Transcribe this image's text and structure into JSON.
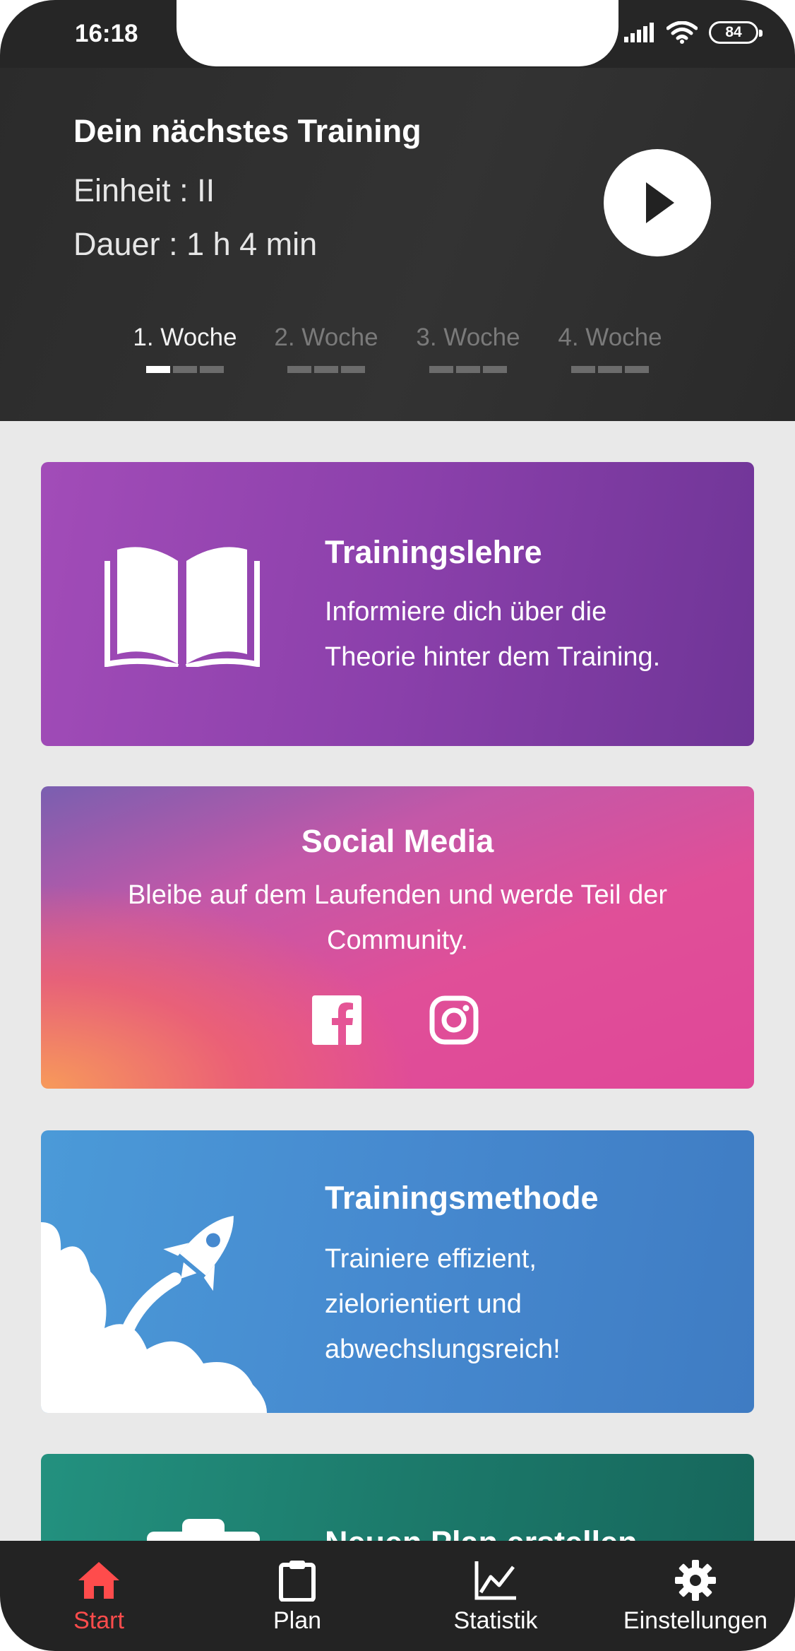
{
  "status_bar": {
    "time": "16:18",
    "battery": "84"
  },
  "next_training": {
    "title": "Dein nächstes Training",
    "unit_line": "Einheit : II",
    "duration_line": "Dauer :  1 h 4 min",
    "weeks": [
      "1. Woche",
      "2. Woche",
      "3. Woche",
      "4. Woche"
    ],
    "active_week": "1. Woche"
  },
  "cards": {
    "trainingslehre": {
      "title": "Trainingslehre",
      "desc_1": "Informiere dich über die",
      "desc_2": "Theorie hinter dem Training.",
      "icon": "open-book-icon"
    },
    "social": {
      "title": "Social Media",
      "desc_1": "Bleibe auf dem Laufenden und werde Teil der",
      "desc_2": "Community.",
      "icons": [
        "facebook-icon",
        "instagram-icon"
      ]
    },
    "methode": {
      "title": "Trainingsmethode",
      "desc_1": "Trainiere effizient,",
      "desc_2": "zielorientiert und",
      "desc_3": "abwechslungsreich!",
      "icon": "rocket-icon"
    },
    "neuer_plan": {
      "title": "Neuen Plan erstellen",
      "icon": "clipboard-icon"
    }
  },
  "bottom_nav": {
    "items": [
      {
        "label": "Start",
        "icon": "home-icon",
        "active": true
      },
      {
        "label": "Plan",
        "icon": "clipboard-icon"
      },
      {
        "label": "Statistik",
        "icon": "chart-icon"
      },
      {
        "label": "Einstellungen",
        "icon": "gear-icon"
      }
    ]
  },
  "colors": {
    "accent": "#ff4c4c",
    "header_bg": "#2e2e2e",
    "card_purple": "#8b40ab",
    "card_blue": "#4689cf",
    "card_teal": "#1c7a6b"
  }
}
